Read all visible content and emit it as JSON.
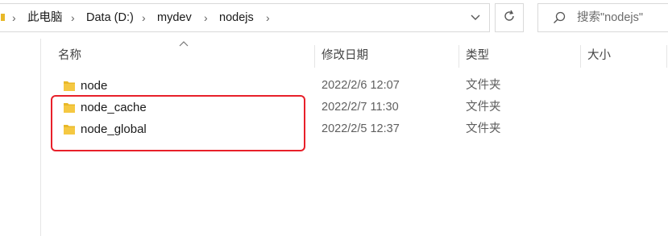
{
  "address_bar": {
    "segments": [
      "此电脑",
      "Data (D:)",
      "mydev",
      "nodejs"
    ]
  },
  "search": {
    "placeholder": "搜索\"nodejs\""
  },
  "columns": {
    "name": "名称",
    "modified": "修改日期",
    "type": "类型",
    "size": "大小"
  },
  "files": [
    {
      "name": "node",
      "modified": "2022/2/6 12:07",
      "type": "文件夹"
    },
    {
      "name": "node_cache",
      "modified": "2022/2/7 11:30",
      "type": "文件夹"
    },
    {
      "name": "node_global",
      "modified": "2022/2/5 12:37",
      "type": "文件夹"
    }
  ],
  "colors": {
    "folder": "#e8b828",
    "highlight": "#e8202a"
  },
  "icons": {
    "breadcrumb_separator": "chevron-right-icon",
    "dropdown": "chevron-down-icon",
    "refresh": "refresh-icon",
    "search": "search-icon",
    "folder": "folder-icon",
    "sort": "sort-up-icon"
  }
}
